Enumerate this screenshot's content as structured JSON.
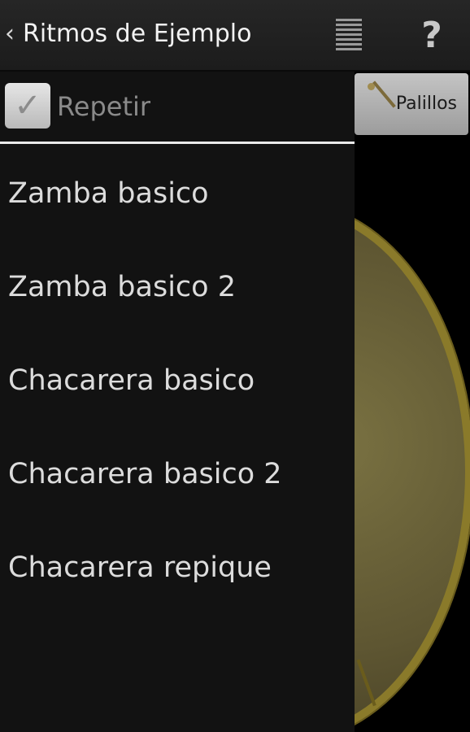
{
  "action_bar": {
    "title": "Ritmos de Ejemplo",
    "up_glyph": "‹",
    "menu_icon": "list-icon",
    "help_glyph": "?"
  },
  "background": {
    "mode_button_label": "Palillos",
    "mode_button_icon": "drumstick-icon"
  },
  "drawer": {
    "repeat": {
      "label": "Repetir",
      "checked": true,
      "check_glyph": "✓"
    },
    "rhythms": [
      {
        "label": "Zamba basico"
      },
      {
        "label": "Zamba basico 2"
      },
      {
        "label": "Chacarera basico"
      },
      {
        "label": "Chacarera basico 2"
      },
      {
        "label": "Chacarera repique"
      }
    ]
  },
  "colors": {
    "drum_rim": "#8a7a2a",
    "drawer_bg": "#121212",
    "divider": "#eaeaea"
  }
}
